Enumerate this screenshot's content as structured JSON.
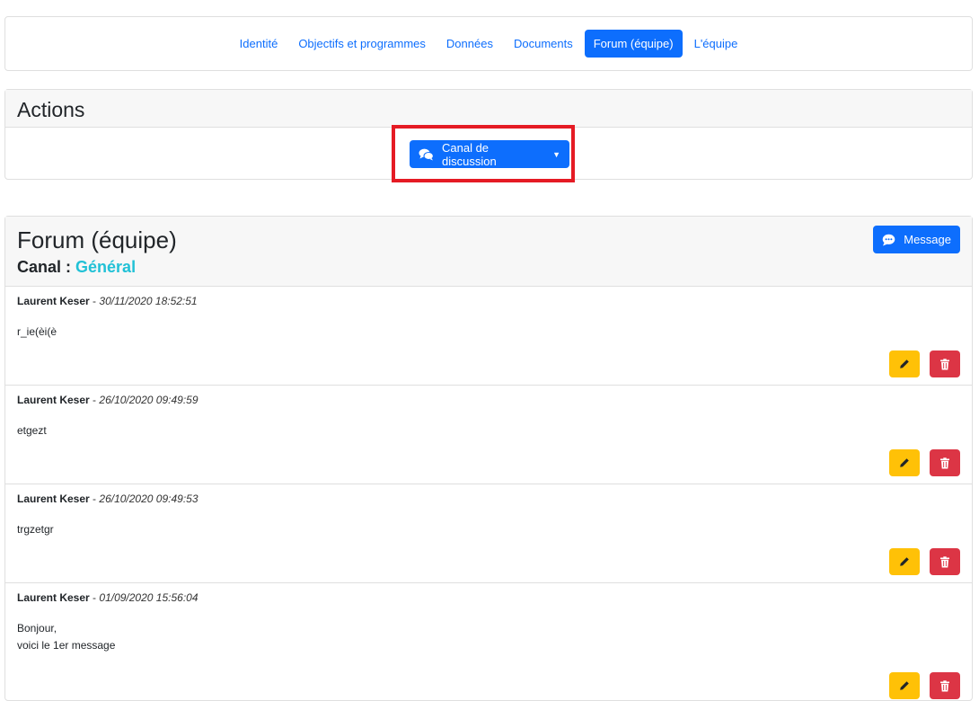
{
  "nav": {
    "items": [
      {
        "label": "Identité",
        "active": false
      },
      {
        "label": "Objectifs et programmes",
        "active": false
      },
      {
        "label": "Données",
        "active": false
      },
      {
        "label": "Documents",
        "active": false
      },
      {
        "label": "Forum (équipe)",
        "active": true
      },
      {
        "label": "L'équipe",
        "active": false
      }
    ]
  },
  "actions": {
    "title": "Actions",
    "channel_button": {
      "label": "Canal de discussion",
      "icon": "comments-icon"
    }
  },
  "forum": {
    "title": "Forum (équipe)",
    "canal_label": "Canal :",
    "canal_name": "Général",
    "message_button": {
      "label": "Message",
      "icon": "comment-dots-icon"
    },
    "messages": [
      {
        "author": "Laurent Keser",
        "date": "30/11/2020 18:52:51",
        "lines": [
          "r_ie(èi(è"
        ]
      },
      {
        "author": "Laurent Keser",
        "date": "26/10/2020 09:49:59",
        "lines": [
          "etgezt"
        ]
      },
      {
        "author": "Laurent Keser",
        "date": "26/10/2020 09:49:53",
        "lines": [
          "trgzetgr"
        ]
      },
      {
        "author": "Laurent Keser",
        "date": "01/09/2020 15:56:04",
        "lines": [
          "Bonjour,",
          "voici le 1er message"
        ]
      }
    ]
  },
  "colors": {
    "primary": "#0d6efd",
    "warning": "#ffc107",
    "danger": "#dc3545",
    "info": "#21c1d6",
    "highlight": "#e51b24"
  }
}
